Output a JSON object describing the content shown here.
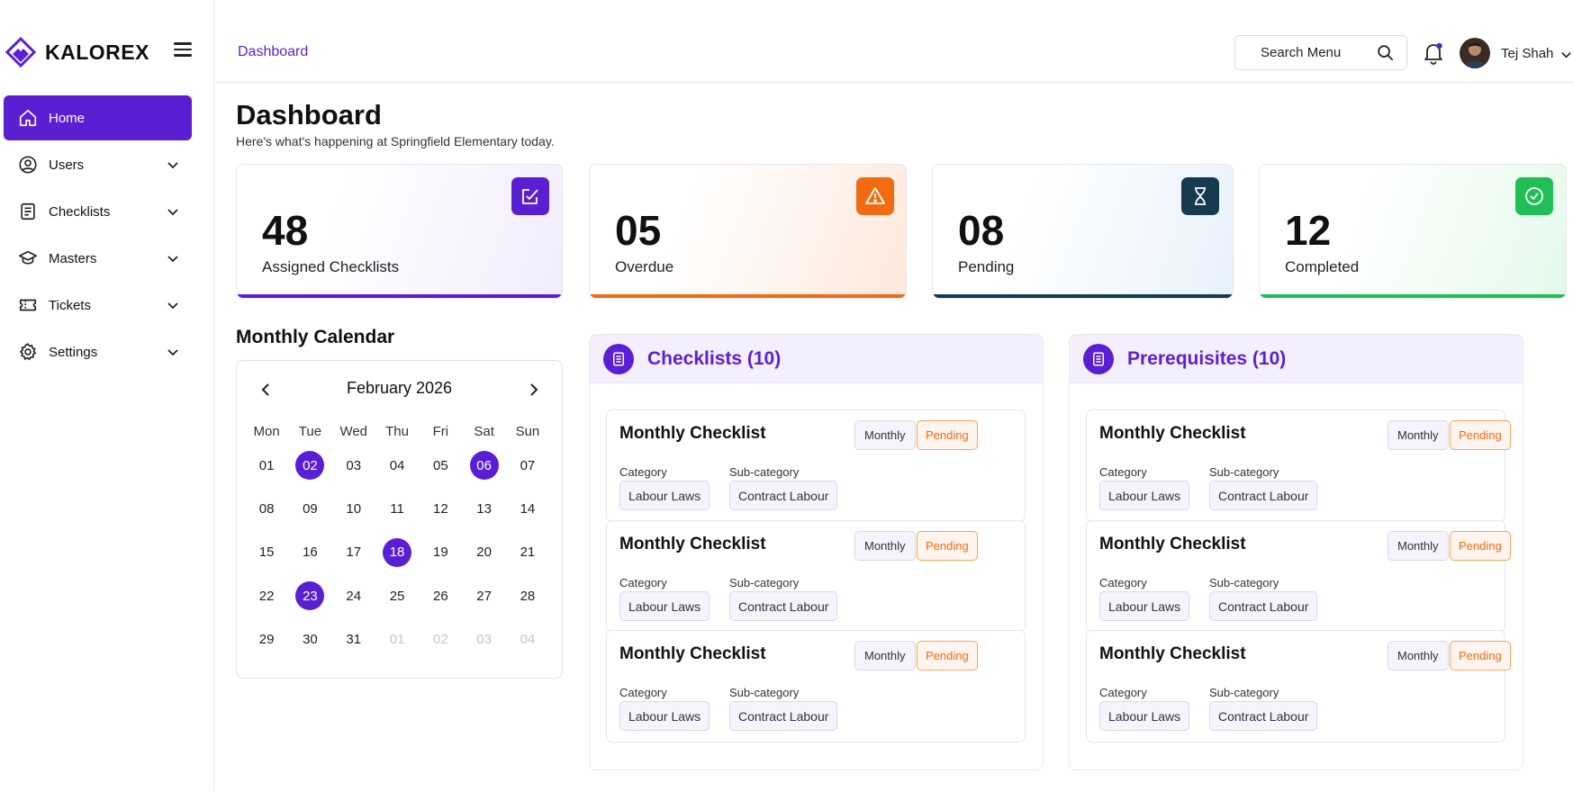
{
  "brand": {
    "name": "KALOREX"
  },
  "sidebar": {
    "items": [
      {
        "label": "Home",
        "icon": "home-icon",
        "active": true
      },
      {
        "label": "Users",
        "icon": "user-circle-icon"
      },
      {
        "label": "Checklists",
        "icon": "checklist-icon"
      },
      {
        "label": "Masters",
        "icon": "graduation-cap-icon"
      },
      {
        "label": "Tickets",
        "icon": "ticket-icon"
      },
      {
        "label": "Settings",
        "icon": "gear-icon"
      }
    ]
  },
  "header": {
    "breadcrumb": "Dashboard",
    "search_label": "Search Menu",
    "user_name": "Tej Shah"
  },
  "page": {
    "title": "Dashboard",
    "subtitle": "Here's what's happening at Springfield Elementary today."
  },
  "stats": [
    {
      "value": "48",
      "label": "Assigned Checklists",
      "icon": "edit-check-icon",
      "color": "#5b1fd3"
    },
    {
      "value": "05",
      "label": "Overdue",
      "icon": "warning-icon",
      "color": "#f26b11"
    },
    {
      "value": "08",
      "label": "Pending",
      "icon": "hourglass-icon",
      "color": "#163a4f"
    },
    {
      "value": "12",
      "label": "Completed",
      "icon": "check-circle-icon",
      "color": "#1fbf55"
    }
  ],
  "calendar": {
    "title": "Monthly Calendar",
    "month": "February 2026",
    "weekdays": [
      "Mon",
      "Tue",
      "Wed",
      "Thu",
      "Fri",
      "Sat",
      "Sun"
    ],
    "days": [
      {
        "d": "01"
      },
      {
        "d": "02",
        "mark": true
      },
      {
        "d": "03"
      },
      {
        "d": "04"
      },
      {
        "d": "05"
      },
      {
        "d": "06",
        "mark": true
      },
      {
        "d": "07"
      },
      {
        "d": "08"
      },
      {
        "d": "09"
      },
      {
        "d": "10"
      },
      {
        "d": "11"
      },
      {
        "d": "12"
      },
      {
        "d": "13"
      },
      {
        "d": "14"
      },
      {
        "d": "15"
      },
      {
        "d": "16"
      },
      {
        "d": "17"
      },
      {
        "d": "18",
        "mark": true
      },
      {
        "d": "19"
      },
      {
        "d": "20"
      },
      {
        "d": "21"
      },
      {
        "d": "22"
      },
      {
        "d": "23",
        "mark": true
      },
      {
        "d": "24"
      },
      {
        "d": "25"
      },
      {
        "d": "26"
      },
      {
        "d": "27"
      },
      {
        "d": "28"
      },
      {
        "d": "29"
      },
      {
        "d": "30"
      },
      {
        "d": "31"
      },
      {
        "d": "01",
        "muted": true
      },
      {
        "d": "02",
        "muted": true
      },
      {
        "d": "03",
        "muted": true
      },
      {
        "d": "04",
        "muted": true
      }
    ]
  },
  "panels": [
    {
      "title": "Checklists (10)",
      "items": [
        {
          "title": "Monthly Checklist",
          "frequency": "Monthly",
          "status": "Pending",
          "category_label": "Category",
          "category": "Labour Laws",
          "subcategory_label": "Sub-category",
          "subcategory": "Contract Labour"
        },
        {
          "title": "Monthly Checklist",
          "frequency": "Monthly",
          "status": "Pending",
          "category_label": "Category",
          "category": "Labour Laws",
          "subcategory_label": "Sub-category",
          "subcategory": "Contract Labour"
        },
        {
          "title": "Monthly Checklist",
          "frequency": "Monthly",
          "status": "Pending",
          "category_label": "Category",
          "category": "Labour Laws",
          "subcategory_label": "Sub-category",
          "subcategory": "Contract Labour"
        }
      ]
    },
    {
      "title": "Prerequisites (10)",
      "items": [
        {
          "title": "Monthly Checklist",
          "frequency": "Monthly",
          "status": "Pending",
          "category_label": "Category",
          "category": "Labour Laws",
          "subcategory_label": "Sub-category",
          "subcategory": "Contract Labour"
        },
        {
          "title": "Monthly Checklist",
          "frequency": "Monthly",
          "status": "Pending",
          "category_label": "Category",
          "category": "Labour Laws",
          "subcategory_label": "Sub-category",
          "subcategory": "Contract Labour"
        },
        {
          "title": "Monthly Checklist",
          "frequency": "Monthly",
          "status": "Pending",
          "category_label": "Category",
          "category": "Labour Laws",
          "subcategory_label": "Sub-category",
          "subcategory": "Contract Labour"
        }
      ]
    }
  ]
}
